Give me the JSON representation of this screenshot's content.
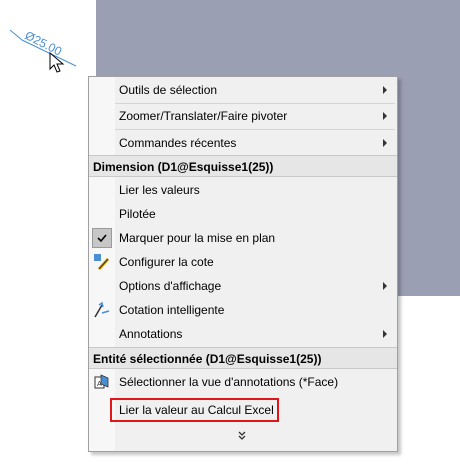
{
  "dimension_text": "Ø25.00",
  "menu": {
    "items": [
      {
        "label": "Outils de sélection"
      },
      {
        "label": "Zoomer/Translater/Faire pivoter"
      },
      {
        "label": "Commandes récentes"
      }
    ],
    "section1_header": "Dimension (D1@Esquisse1(25))",
    "section1_items": [
      {
        "label": "Lier les valeurs"
      },
      {
        "label": "Pilotée"
      },
      {
        "label": "Marquer pour la mise en plan",
        "checked": true
      },
      {
        "label": "Configurer la cote"
      },
      {
        "label": "Options d'affichage"
      },
      {
        "label": "Cotation intelligente"
      },
      {
        "label": "Annotations"
      }
    ],
    "section2_header": "Entité sélectionnée (D1@Esquisse1(25))",
    "section2_items": [
      {
        "label": "Sélectionner la vue d'annotations (*Face)"
      },
      {
        "label": "Lier la valeur au Calcul Excel"
      }
    ]
  },
  "colors": {
    "canvas": "#9b9fb3",
    "dimension": "#4a8fd6",
    "highlight": "#e0161b"
  }
}
